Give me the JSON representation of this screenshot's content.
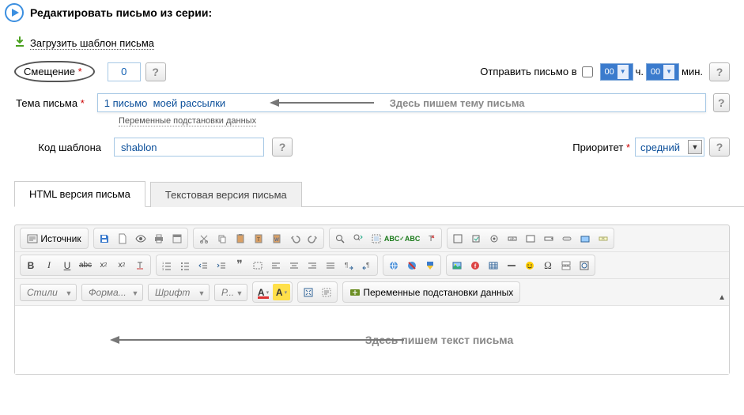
{
  "page": {
    "title": "Редактировать письмо из серии:"
  },
  "load_template": {
    "label": "Загрузить шаблон письма"
  },
  "offset": {
    "label": "Смещение",
    "value": "0"
  },
  "send_at": {
    "label": "Отправить письмо в",
    "hours": "00",
    "hours_unit": "ч.",
    "minutes": "00",
    "minutes_unit": "мин."
  },
  "subject": {
    "label": "Тема письма",
    "value": "1 письмо  моей рассылки",
    "hint": "Здесь пишем тему  письма",
    "vars_link": "Переменные подстановки данных"
  },
  "template_code": {
    "label": "Код шаблона",
    "value": "shablon"
  },
  "priority": {
    "label": "Приоритет",
    "value": "средний"
  },
  "tabs": {
    "html": "HTML версия письма",
    "text": "Текстовая версия письма"
  },
  "editor_hint": "Здесь пишем  текст письма",
  "toolbar": {
    "source": "Источник",
    "styles": "Стили",
    "format": "Форма...",
    "font": "Шрифт",
    "size": "Р...",
    "textcolor": "A",
    "bgcolor": "A",
    "vars_button": "Переменные подстановки данных"
  }
}
